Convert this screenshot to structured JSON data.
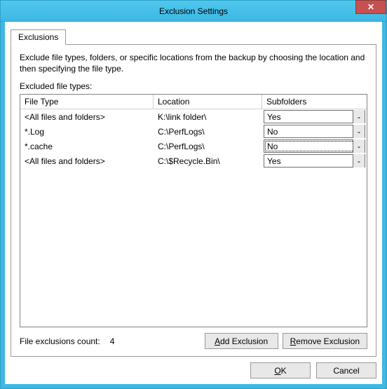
{
  "window": {
    "title": "Exclusion Settings",
    "close": "✕"
  },
  "tab": {
    "label": "Exclusions"
  },
  "description": "Exclude file types, folders, or specific locations from the backup by choosing the location and then specifying the file type.",
  "excludedLabel": "Excluded file types:",
  "columns": {
    "fileType": "File Type",
    "location": "Location",
    "subfolders": "Subfolders"
  },
  "rows": [
    {
      "fileType": "<All files and folders>",
      "location": "K:\\link folder\\",
      "subfolders": "Yes",
      "focused": false
    },
    {
      "fileType": "*.Log",
      "location": "C:\\PerfLogs\\",
      "subfolders": "No",
      "focused": false
    },
    {
      "fileType": "*.cache",
      "location": "C:\\PerfLogs\\",
      "subfolders": "No",
      "focused": true
    },
    {
      "fileType": "<All files and folders>",
      "location": "C:\\$Recycle.Bin\\",
      "subfolders": "Yes",
      "focused": false
    }
  ],
  "footer": {
    "countLabel": "File exclusions count:",
    "countValue": "4",
    "addBtn": {
      "pre": "",
      "u": "A",
      "post": "dd Exclusion"
    },
    "removeBtn": {
      "pre": "",
      "u": "R",
      "post": "emove Exclusion"
    }
  },
  "dialogButtons": {
    "ok": {
      "pre": "",
      "u": "O",
      "post": "K"
    },
    "cancel": "Cancel"
  }
}
